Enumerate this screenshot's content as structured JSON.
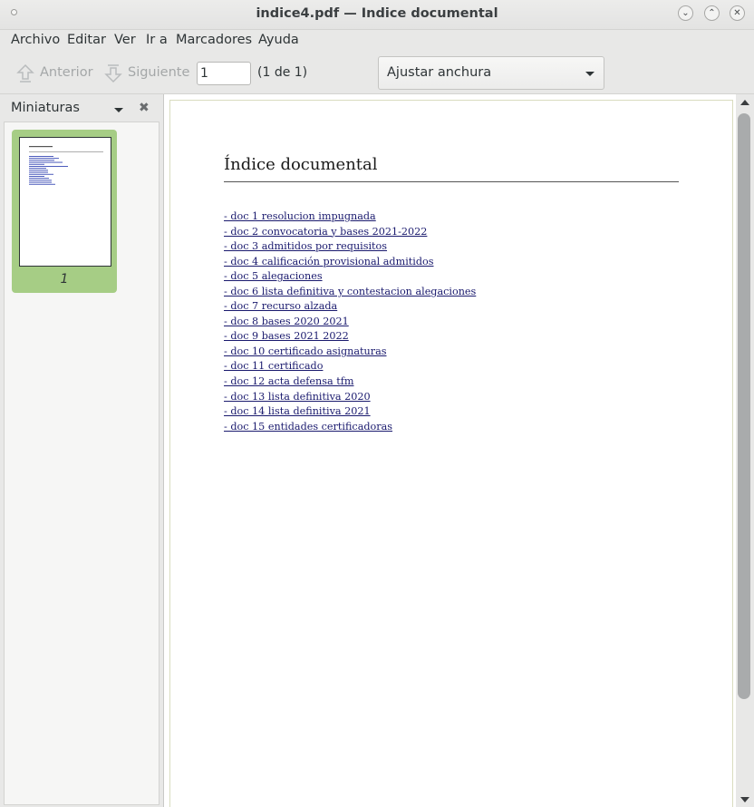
{
  "window": {
    "title": "indice4.pdf — Indice documental",
    "buttons": {
      "minimize_icon": "chevron-down-icon",
      "maximize_icon": "chevron-up-icon",
      "close_icon": "close-icon"
    }
  },
  "menubar": {
    "items": [
      "Archivo",
      "Editar",
      "Ver",
      "Ir a",
      "Marcadores",
      "Ayuda"
    ]
  },
  "toolbar": {
    "prev_label": "Anterior",
    "next_label": "Siguiente",
    "page_value": "1",
    "page_count": "(1 de 1)",
    "zoom_value": "Ajustar anchura"
  },
  "sidebar": {
    "header_label": "Miniaturas",
    "thumbnails": [
      {
        "page_number": "1"
      }
    ]
  },
  "document": {
    "title": "Índice documental",
    "links": [
      "- doc 1 resolucion impugnada",
      "- doc 2 convocatoria y bases 2021-2022",
      "- doc 3 admitidos por requisitos",
      "- doc 4 calificación provisional admitidos",
      "- doc 5 alegaciones",
      "- doc 6 lista definitiva y contestacion alegaciones",
      "- doc 7 recurso alzada",
      "- doc 8 bases 2020 2021",
      "- doc 9 bases 2021 2022",
      "- doc 10 certificado asignaturas",
      "- doc 11 certificado",
      "- doc 12 acta defensa tfm",
      "- doc 13 lista definitiva 2020",
      "- doc 14 lista definitiva 2021",
      "- doc 15 entidades certificadoras"
    ]
  },
  "colors": {
    "thumb_selected": "#a6cd85",
    "link": "#1a1a6e",
    "disabled_text": "#a4a7a8"
  }
}
